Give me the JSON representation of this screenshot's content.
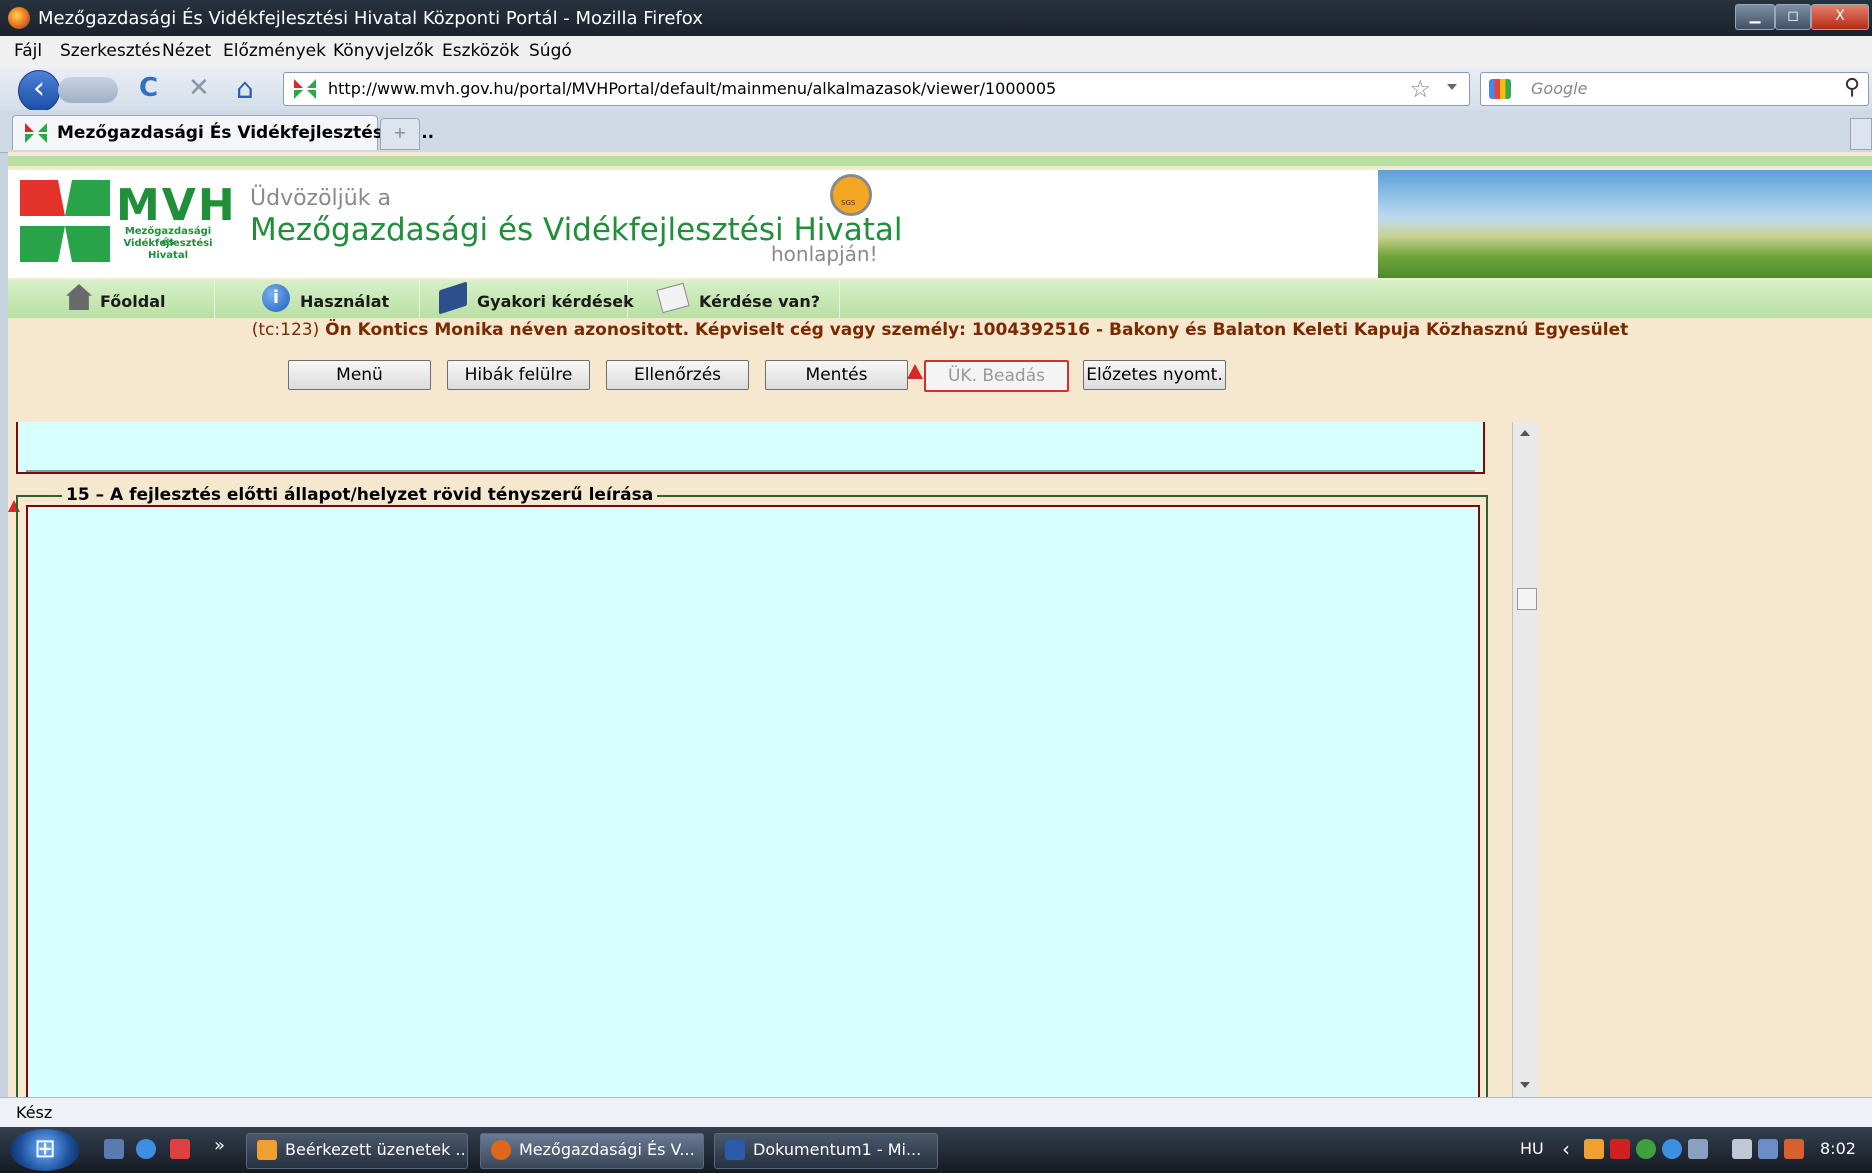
{
  "window": {
    "title": "Mezőgazdasági És Vidékfejlesztési Hivatal Központi Portál - Mozilla Firefox",
    "controls": {
      "minimize": "▁",
      "maximize": "◻",
      "close": "X"
    }
  },
  "menu": [
    "Fájl",
    "Szerkesztés",
    "Nézet",
    "Előzmények",
    "Könyvjelzők",
    "Eszközök",
    "Súgó"
  ],
  "nav": {
    "back": "‹",
    "reload": "C",
    "stop": "✕",
    "home": "⌂",
    "url": "http://www.mvh.gov.hu/portal/MVHPortal/default/mainmenu/alkalmazasok/viewer/1000005",
    "bookmark_star": "☆",
    "search_placeholder": "Google",
    "search_icon": "⚲"
  },
  "tabs": [
    {
      "label": "Mezőgazdasági És Vidékfejlesztési Hi..."
    }
  ],
  "new_tab": "+",
  "header": {
    "logo_text": "MVH",
    "logo_sub": [
      "Mezőgazdasági és",
      "Vidékfejlesztési",
      "Hivatal"
    ],
    "welcome_line1": "Üdvözöljük a",
    "welcome_line2": "Mezőgazdasági és Vidékfejlesztési Hivatal",
    "welcome_line3": "honlapján!",
    "badge_text": "SGS"
  },
  "topnav": [
    "Főoldal",
    "Használat",
    "Gyakori kérdések",
    "Kérdése van?"
  ],
  "userinfo": {
    "prefix": "(tc:123)",
    "text": " Ön Kontics Monika néven azonositott.  Képviselt cég vagy személy: 1004392516 - Bakony és Balaton Keleti Kapuja Közhasznú Egyesület"
  },
  "buttons": [
    "Menü",
    "Hibák felülre",
    "Ellenőrzés",
    "Mentés",
    "ÜK. Beadás",
    "Előzetes nyomt."
  ],
  "section15": {
    "number": "15",
    "title": "A fejlesztés előtti állapot/helyzet rövid tényszerű leírása",
    "value": ""
  },
  "status": "Kész",
  "taskbar": {
    "start": "⊞",
    "overflow": "»",
    "tasks": [
      "Beérkezett üzenetek ...",
      "Mezőgazdasági És V...",
      "Dokumentum1 - Mi..."
    ],
    "lang": "HU",
    "tray_arrow": "‹",
    "clock": "8:02"
  }
}
